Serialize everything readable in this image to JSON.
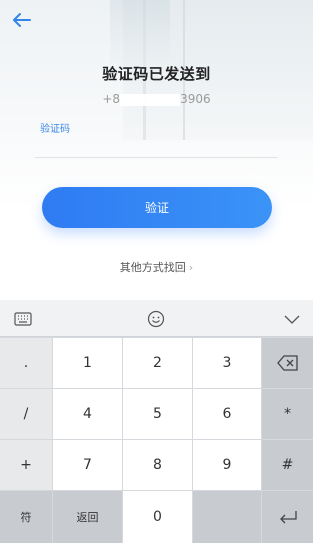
{
  "header": {
    "back_icon": "arrow-left-icon",
    "title": "验证码已发送到",
    "phone_prefix": "+8",
    "phone_suffix": "3906"
  },
  "form": {
    "code_label": "验证码",
    "verify_label": "验证",
    "other_method": "其他方式找回",
    "other_chevron": "›"
  },
  "keyboard": {
    "symbols": [
      ".",
      "/",
      "+",
      "-"
    ],
    "digits": [
      "1",
      "2",
      "3",
      "4",
      "5",
      "6",
      "7",
      "8",
      "9",
      "0"
    ],
    "right_keys": [
      "*",
      "#"
    ],
    "fu_label": "符",
    "back_label": "返回",
    "accent": "#3a86e8"
  }
}
